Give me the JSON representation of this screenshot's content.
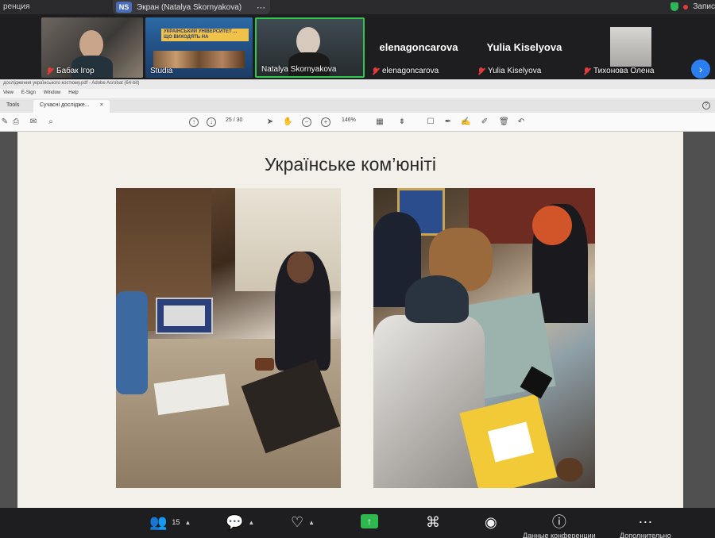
{
  "zoom": {
    "window_title": "ренция",
    "share_badge": "NS",
    "share_label": "Экран (Natalya Skornyakova)",
    "recording_label": "Запис",
    "participants": [
      {
        "name": "Бабак Ігор",
        "muted": true
      },
      {
        "name": "Studia",
        "muted": false
      },
      {
        "name": "Natalya Skornyakova",
        "muted": false,
        "active_speaker": true
      },
      {
        "name": "elenagoncarova",
        "muted": true
      },
      {
        "name": "Yulia Kiselyova",
        "muted": true
      },
      {
        "name": "Тихонова Олена",
        "muted": true
      }
    ],
    "studio_banner": "УКРАЇНСЬКИЙ УНІВЕРСИТЕТ ... ЩО ВИХОДЯТЬ НА",
    "bottom_bar": {
      "participants_count": "15",
      "items": [
        {
          "label": "",
          "icon": "participants-icon"
        },
        {
          "label": "",
          "icon": "chat-icon"
        },
        {
          "label": "",
          "icon": "reactions-icon"
        },
        {
          "label": "",
          "icon": "share-screen-icon"
        },
        {
          "label": "",
          "icon": "apps-icon"
        },
        {
          "label": "",
          "icon": "record-icon"
        },
        {
          "label": "Данные конференции",
          "icon": "info-icon"
        },
        {
          "label": "Дополнительно",
          "icon": "more-icon"
        }
      ]
    }
  },
  "acrobat": {
    "title_bar": "дослідження українського костюму.pdf - Adobe Acrobat (64-bit)",
    "menu": [
      "View",
      "E-Sign",
      "Window",
      "Help"
    ],
    "tabs": [
      {
        "label": "Tools"
      },
      {
        "label": "Сучасні дослідже...",
        "close": "×"
      }
    ],
    "page_current": "25",
    "page_separator": "/",
    "page_total": "30",
    "zoom_level": "146%"
  },
  "slide": {
    "title": "Українське ком’юніті"
  }
}
